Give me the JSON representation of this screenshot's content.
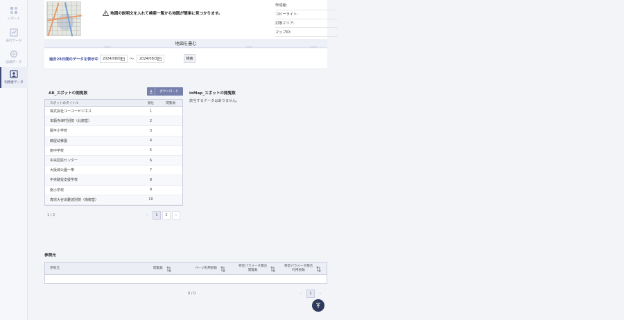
{
  "sidebar": {
    "items": [
      {
        "label": "レポート",
        "icon": "report-icon",
        "active": false
      },
      {
        "label": "表行データ",
        "icon": "table-data-icon",
        "active": false
      },
      {
        "label": "詳細データ",
        "icon": "detail-data-icon",
        "active": false
      },
      {
        "label": "利用者データ",
        "icon": "user-data-icon",
        "active": true
      }
    ]
  },
  "map_card": {
    "warning": "地図の説明文を入れて検索一覧から地図が簡単に見つかります。",
    "meta": [
      "作成者:",
      "コピーライト:",
      "対象エリア:",
      "マップID:"
    ],
    "collapse_label": "地図を畳む"
  },
  "filter": {
    "label": "過去28日間のデータを表示中",
    "start_date": "2024/08/01",
    "separator": "〜",
    "end_date": "2024/08/30",
    "search_label": "検索"
  },
  "spot_views": {
    "title": "AR_スポットの閲覧数",
    "download_label": "ダウンロード",
    "columns": [
      "スポットのタイトル",
      "順位",
      "閲覧数"
    ],
    "rows": [
      [
        "株式会社ユーユービジネス",
        "1",
        ""
      ],
      [
        "本願寺津村別院（北御堂）",
        "2",
        ""
      ],
      [
        "開平小学校",
        "3",
        ""
      ],
      [
        "錦屋幼稚園",
        "4",
        ""
      ],
      [
        "南中学校",
        "5",
        ""
      ],
      [
        "中央区民センター",
        "6",
        ""
      ],
      [
        "大阪城公園一帯",
        "7",
        ""
      ],
      [
        "中央聴覚支援学校",
        "8",
        ""
      ],
      [
        "南小学校",
        "9",
        ""
      ],
      [
        "真宗大谷派難波別院（南御堂）",
        "10",
        ""
      ]
    ],
    "page_count": "1 / 2",
    "pages": [
      "1",
      "2"
    ],
    "active_page": "1"
  },
  "inmap_views": {
    "title": "inMap_スポットの閲覧数",
    "empty": "該当するデータはありません。"
  },
  "referrer": {
    "title": "参照元",
    "columns": [
      "参照元",
      "閲覧数",
      "ページ利用者数",
      "特定パラメータ都合\n閲覧数",
      "特定パラメータ都合\n利用者数"
    ],
    "page_count": "0 / 0",
    "active_page": "1"
  },
  "colors": {
    "accent": "#3b4aa0",
    "button": "#7680ad",
    "fab": "#2d3a5c"
  }
}
